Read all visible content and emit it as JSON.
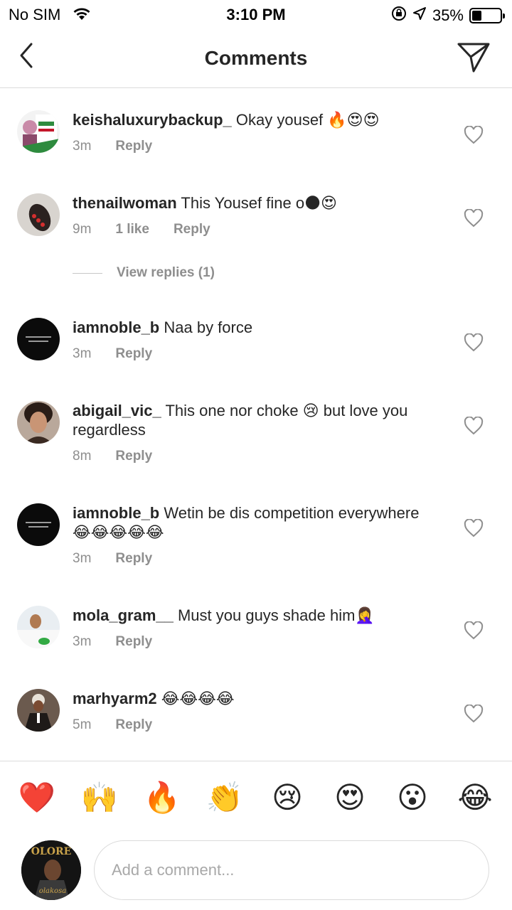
{
  "status_bar": {
    "carrier": "No SIM",
    "time": "3:10 PM",
    "battery": "35%",
    "battery_level": 0.35
  },
  "header": {
    "title": "Comments"
  },
  "comments": [
    {
      "username": "keishaluxurybackup_",
      "text": " Okay yousef 🔥😍😍",
      "time": "3m",
      "likes": "",
      "reply": "Reply"
    },
    {
      "username": "thenailwoman",
      "text": " This Yousef fine o🌑😍",
      "time": "9m",
      "likes": "1 like",
      "reply": "Reply"
    },
    {
      "username": "iamnoble_b",
      "text": " Naa by force",
      "time": "3m",
      "likes": "",
      "reply": "Reply"
    },
    {
      "username": "abigail_vic_",
      "text": " This one nor choke 😢 but love you regardless",
      "time": "8m",
      "likes": "",
      "reply": "Reply"
    },
    {
      "username": "iamnoble_b",
      "text": " Wetin be dis competition everywhere😂😂😂😂😂",
      "time": "3m",
      "likes": "",
      "reply": "Reply"
    },
    {
      "username": "mola_gram__",
      "text": " Must you guys shade him🤦‍♀️",
      "time": "3m",
      "likes": "",
      "reply": "Reply"
    },
    {
      "username": "marhyarm2",
      "text": " 😂😂😂😂",
      "time": "5m",
      "likes": "",
      "reply": "Reply"
    }
  ],
  "view_replies": "View replies (1)",
  "emoji_bar": [
    "❤️",
    "🙌",
    "🔥",
    "👏",
    "😢",
    "😍",
    "😮",
    "😂"
  ],
  "input": {
    "placeholder": "Add a comment..."
  },
  "my_avatar": {
    "text_top": "OLORE",
    "text_bottom": "olakosa"
  },
  "colors": {
    "secondary_text": "#8e8e8e",
    "divider": "#dbdbdb",
    "primary_text": "#262626"
  }
}
